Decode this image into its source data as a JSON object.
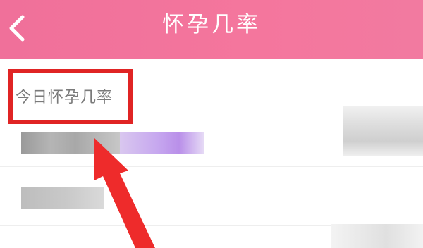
{
  "header": {
    "title": "怀孕几率",
    "back_icon": "chevron-left-icon"
  },
  "main": {
    "row_label": "今日怀孕几率"
  },
  "colors": {
    "header": "#f27aa0",
    "highlight": "#e02424",
    "arrow": "#ee2b2b"
  }
}
